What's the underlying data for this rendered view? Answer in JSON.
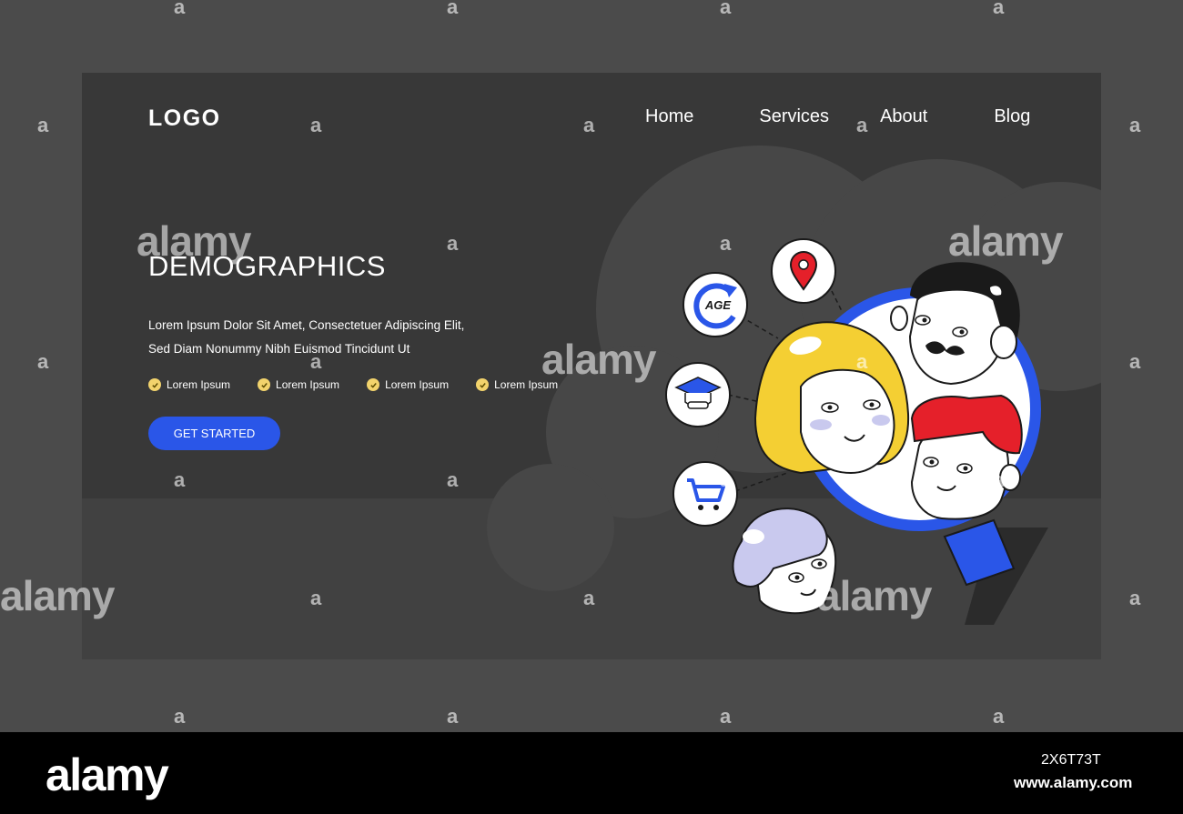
{
  "header": {
    "logo": "LOGO",
    "nav": [
      "Home",
      "Services",
      "About",
      "Blog"
    ]
  },
  "hero": {
    "title": "DEMOGRAPHICS",
    "description": "Lorem Ipsum Dolor Sit Amet, Consectetuer Adipiscing Elit, Sed Diam Nonummy Nibh Euismod Tincidunt Ut",
    "checklist": [
      "Lorem Ipsum",
      "Lorem Ipsum",
      "Lorem Ipsum",
      "Lorem Ipsum"
    ],
    "cta_label": "GET STARTED"
  },
  "illustration": {
    "age_icon_label": "AGE",
    "icons": [
      "location-pin-icon",
      "age-icon",
      "graduation-cap-icon",
      "shopping-cart-icon",
      "magnifying-glass-icon"
    ]
  },
  "watermark": {
    "brand": "alamy",
    "mark": "a"
  },
  "footer": {
    "brand": "alamy",
    "image_id": "2X6T73T",
    "url": "www.alamy.com"
  },
  "colors": {
    "page_bg": "#4b4b4b",
    "card_bg": "#383838",
    "accent_blue": "#2a56e8",
    "check_yellow": "#f2d36c",
    "hair_blonde": "#f4cf33",
    "hair_red": "#e5202a",
    "hair_lilac": "#c9c9ee"
  }
}
